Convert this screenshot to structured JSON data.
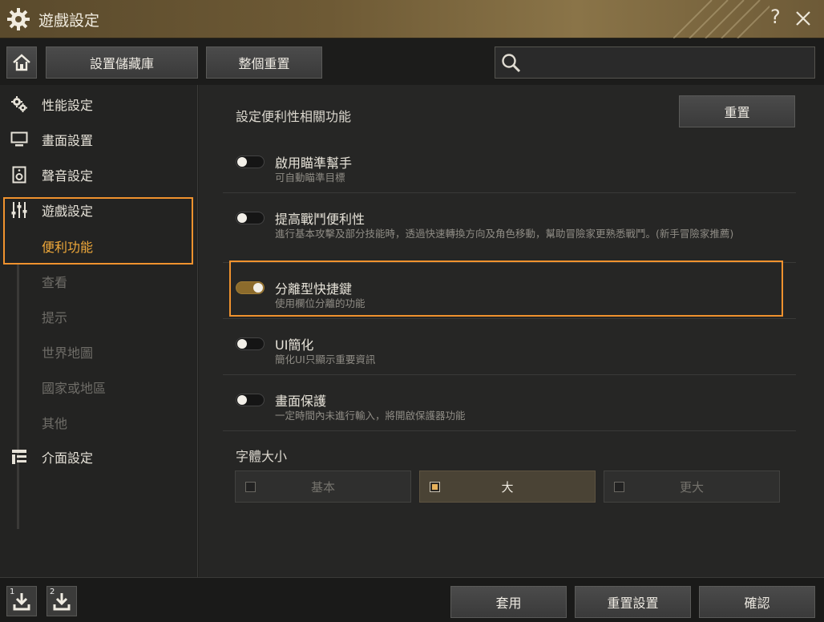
{
  "window": {
    "title": "遊戲設定",
    "help_label": "?"
  },
  "toolbar": {
    "save_library": "設置儲藏庫",
    "reset_all": "整個重置",
    "search_placeholder": ""
  },
  "sidebar": {
    "items": [
      {
        "label": "性能設定",
        "icon": "gears-icon"
      },
      {
        "label": "畫面設置",
        "icon": "monitor-icon"
      },
      {
        "label": "聲音設定",
        "icon": "speaker-icon"
      },
      {
        "label": "遊戲設定",
        "icon": "sliders-icon"
      },
      {
        "label": "介面設定",
        "icon": "layout-icon"
      }
    ],
    "sub_items": [
      {
        "label": "便利功能",
        "active": true
      },
      {
        "label": "查看",
        "active": false
      },
      {
        "label": "提示",
        "active": false
      },
      {
        "label": "世界地圖",
        "active": false
      },
      {
        "label": "國家或地區",
        "active": false
      },
      {
        "label": "其他",
        "active": false
      }
    ]
  },
  "main": {
    "section_title": "設定便利性相關功能",
    "reset_label": "重置",
    "options": [
      {
        "name": "啟用瞄準幫手",
        "desc": "可自動瞄準目標",
        "on": false
      },
      {
        "name": "提高戰鬥便利性",
        "desc": "進行基本攻擊及部分技能時，透過快速轉換方向及角色移動，幫助冒險家更熟悉戰鬥。(新手冒險家推薦)",
        "on": false
      },
      {
        "name": "分離型快捷鍵",
        "desc": "使用欄位分離的功能",
        "on": true
      },
      {
        "name": "UI簡化",
        "desc": "簡化UI只顯示重要資訊",
        "on": false
      },
      {
        "name": "畫面保護",
        "desc": "一定時間內未進行輸入，將開啟保護器功能",
        "on": false
      }
    ],
    "font_size": {
      "label": "字體大小",
      "options": [
        "基本",
        "大",
        "更大"
      ],
      "selected": "大"
    }
  },
  "footer": {
    "preset1_label": "1",
    "preset2_label": "2",
    "apply": "套用",
    "reset_settings": "重置設置",
    "confirm": "確認"
  },
  "colors": {
    "accent": "#f0a93a",
    "highlight_box": "#f0922e",
    "toggle_on": "#8c6b2c"
  }
}
